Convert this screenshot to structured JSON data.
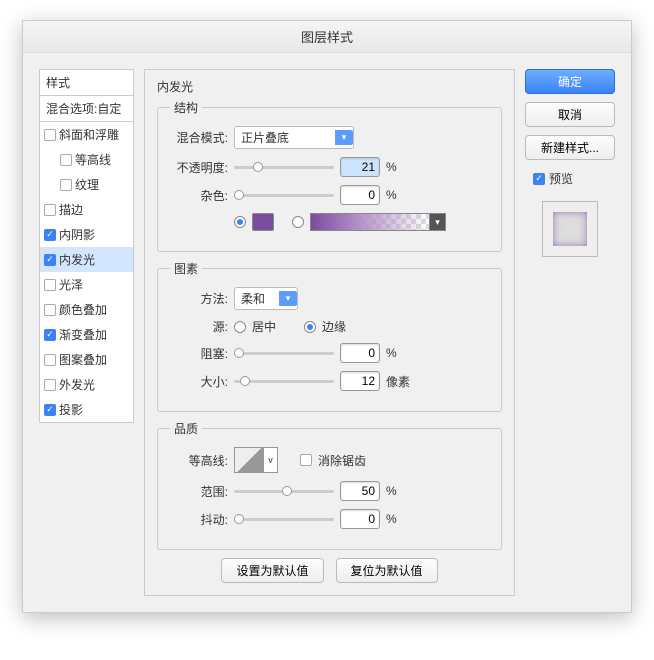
{
  "title": "图层样式",
  "sidebar": {
    "styles_label": "样式",
    "blend_options_label": "混合选项:自定",
    "items": [
      {
        "label": "斜面和浮雕",
        "checked": false,
        "indent": false
      },
      {
        "label": "等高线",
        "checked": false,
        "indent": true
      },
      {
        "label": "纹理",
        "checked": false,
        "indent": true
      },
      {
        "label": "描边",
        "checked": false,
        "indent": false
      },
      {
        "label": "内阴影",
        "checked": true,
        "indent": false
      },
      {
        "label": "内发光",
        "checked": true,
        "indent": false,
        "selected": true
      },
      {
        "label": "光泽",
        "checked": false,
        "indent": false
      },
      {
        "label": "颜色叠加",
        "checked": false,
        "indent": false
      },
      {
        "label": "渐变叠加",
        "checked": true,
        "indent": false
      },
      {
        "label": "图案叠加",
        "checked": false,
        "indent": false
      },
      {
        "label": "外发光",
        "checked": false,
        "indent": false
      },
      {
        "label": "投影",
        "checked": true,
        "indent": false
      }
    ]
  },
  "main": {
    "title": "内发光",
    "structure": {
      "legend": "结构",
      "blend_mode_label": "混合模式:",
      "blend_mode_value": "正片叠底",
      "opacity_label": "不透明度:",
      "opacity_value": "21",
      "opacity_unit": "%",
      "noise_label": "杂色:",
      "noise_value": "0",
      "noise_unit": "%",
      "solid_color": "#7a4d9e"
    },
    "elements": {
      "legend": "图素",
      "technique_label": "方法:",
      "technique_value": "柔和",
      "source_label": "源:",
      "source_center": "居中",
      "source_edge": "边缘",
      "choke_label": "阻塞:",
      "choke_value": "0",
      "choke_unit": "%",
      "size_label": "大小:",
      "size_value": "12",
      "size_unit": "像素"
    },
    "quality": {
      "legend": "品质",
      "contour_label": "等高线:",
      "antialias_label": "消除锯齿",
      "range_label": "范围:",
      "range_value": "50",
      "range_unit": "%",
      "jitter_label": "抖动:",
      "jitter_value": "0",
      "jitter_unit": "%"
    },
    "default_button": "设置为默认值",
    "reset_button": "复位为默认值"
  },
  "right": {
    "ok": "确定",
    "cancel": "取消",
    "new_style": "新建样式...",
    "preview_label": "预览"
  }
}
